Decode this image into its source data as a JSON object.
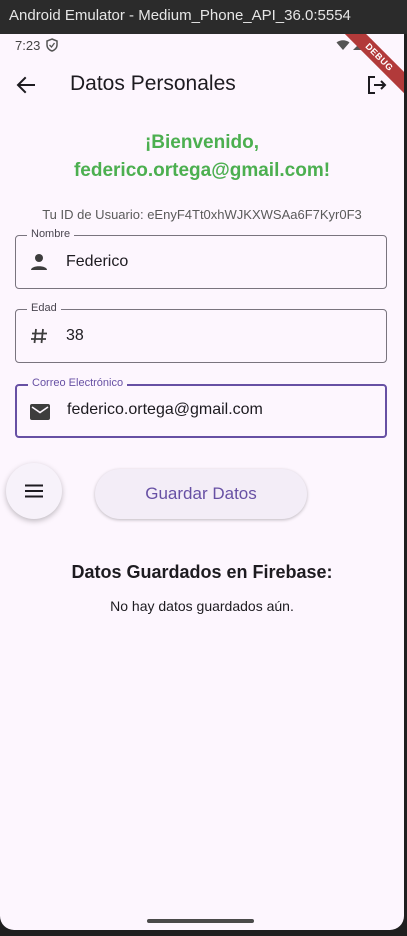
{
  "window": {
    "title": "Android Emulator - Medium_Phone_API_36.0:5554"
  },
  "statusbar": {
    "time": "7:23",
    "debug_banner": "DEBUG"
  },
  "appbar": {
    "title": "Datos Personales"
  },
  "welcome": {
    "line1": "¡Bienvenido,",
    "line2": "federico.ortega@gmail.com!"
  },
  "user_id": "Tu ID de Usuario: eEnyF4Tt0xhWJKXWSAa6F7Kyr0F3",
  "fields": {
    "name": {
      "label": "Nombre",
      "value": "Federico",
      "icon": "person-icon"
    },
    "age": {
      "label": "Edad",
      "value": "38",
      "icon": "hash-icon"
    },
    "email": {
      "label": "Correo Electrónico",
      "value": "federico.ortega@gmail.com",
      "icon": "mail-icon"
    }
  },
  "save_button": "Guardar Datos",
  "saved": {
    "title": "Datos Guardados en Firebase:",
    "empty": "No hay datos guardados aún."
  },
  "colors": {
    "accent": "#6750a4",
    "welcome": "#4caf50",
    "background": "#fdf6fe"
  }
}
